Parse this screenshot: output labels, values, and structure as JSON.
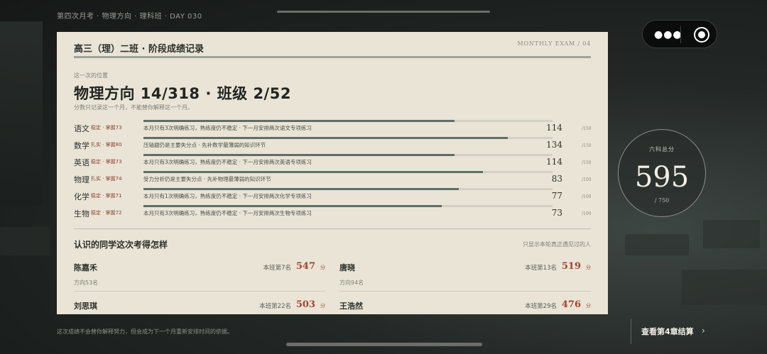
{
  "breadcrumb": "第四次月考 · 物理方向 · 理科班 · DAY 030",
  "card": {
    "title": "高三（理）二班 · 阶段成绩记录",
    "tag": "MONTHLY EXAM / 04",
    "position_caption": "这一次的位置",
    "position_main": "物理方向 14/318 · 班级 2/52",
    "position_note": "分数只记录这一个月，不能替你解释这一个月。"
  },
  "subjects": [
    {
      "name": "语文",
      "tag": "稳定 · 掌握73",
      "note": "本月只有3次明确练习，熟练度仍不稳定 · 下一月安排两次语文专项练习",
      "score": "114",
      "full": "/150",
      "fill": 0.76
    },
    {
      "name": "数学",
      "tag": "扎实 · 掌握80",
      "note": "压轴题仍是主要失分点 · 先补数学最薄弱的知识环节",
      "score": "134",
      "full": "/150",
      "fill": 0.89
    },
    {
      "name": "英语",
      "tag": "稳定 · 掌握73",
      "note": "本月只有3次明确练习，熟练度仍不稳定 · 下一月安排两次英语专项练习",
      "score": "114",
      "full": "/150",
      "fill": 0.76
    },
    {
      "name": "物理",
      "tag": "扎实 · 掌握74",
      "note": "受力分析仍是主要失分点 · 先补物理最薄弱的知识环节",
      "score": "83",
      "full": "/100",
      "fill": 0.83
    },
    {
      "name": "化学",
      "tag": "稳定 · 掌握71",
      "note": "本月只有1次明确练习，熟练度仍不稳定 · 下一月安排两次化学专项练习",
      "score": "77",
      "full": "/100",
      "fill": 0.77
    },
    {
      "name": "生物",
      "tag": "稳定 · 掌握72",
      "note": "本月只有3次明确练习，熟练度仍不稳定 · 下一月安排两次生物专项练习",
      "score": "73",
      "full": "/100",
      "fill": 0.73
    }
  ],
  "peers_section": {
    "title": "认识的同学这次考得怎样",
    "note": "只显示本轮真正遇见过的人",
    "unit": "分",
    "peers": [
      {
        "name": "陈嘉禾",
        "rank": "本班第7名",
        "score": "547",
        "sub": "方向53名"
      },
      {
        "name": "唐晓",
        "rank": "本班第13名",
        "score": "519",
        "sub": "方向94名"
      },
      {
        "name": "刘思琪",
        "rank": "本班第22名",
        "score": "503",
        "sub": ""
      },
      {
        "name": "王浩然",
        "rank": "本班第29名",
        "score": "476",
        "sub": ""
      }
    ]
  },
  "total": {
    "label": "六科总分",
    "value": "595",
    "max": "/ 750"
  },
  "footer": {
    "note": "这次成绩不会替你解释努力，但会成为下一个月重新安排时间的依据。",
    "next_label": "查看第4章结算",
    "next_arrow": "›"
  },
  "capsule": {
    "more_icon": "more-dots-icon",
    "close_icon": "target-close-icon"
  }
}
